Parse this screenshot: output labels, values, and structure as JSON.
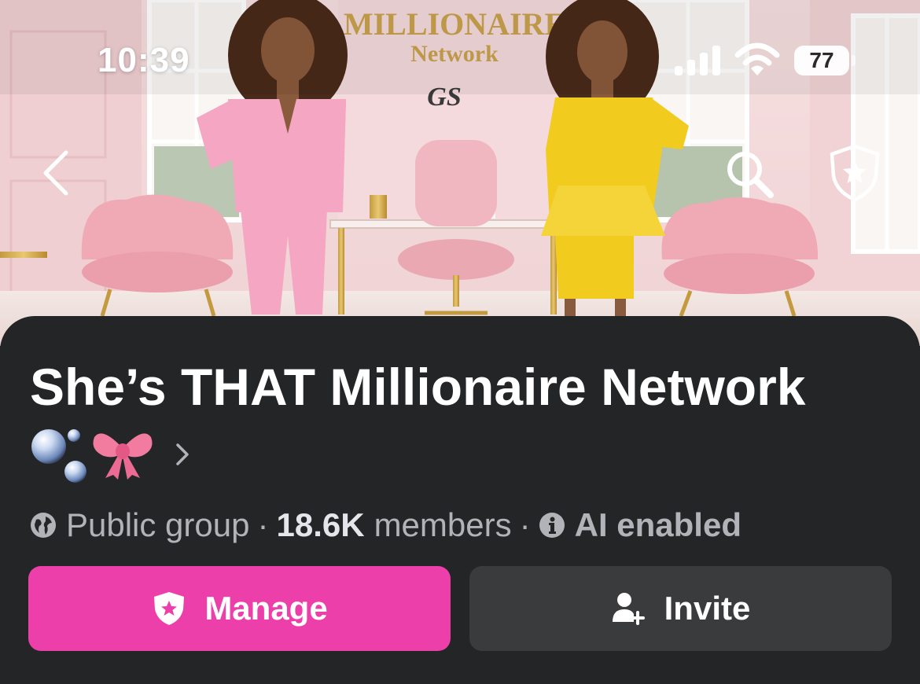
{
  "status_bar": {
    "time": "10:39",
    "battery_level": "77"
  },
  "cover": {
    "brand_title": "MILLIONAIRE",
    "brand_subtitle": "Network",
    "logo_monogram": "GS"
  },
  "group": {
    "name": "She’s THAT Millionaire Network",
    "privacy": "Public group",
    "member_count": "18.6K",
    "members_label": "members",
    "ai_status": "AI enabled"
  },
  "actions": {
    "manage_label": "Manage",
    "invite_label": "Invite"
  },
  "colors": {
    "panel_bg": "#242526",
    "manage_button": "#ec3fa9",
    "invite_button": "#3a3b3c"
  },
  "icons": {
    "back": "chevron-left-icon",
    "search": "search-icon",
    "admin": "admin-shield-icon",
    "privacy": "globe-icon",
    "ai": "info-icon",
    "manage": "shield-star-icon",
    "invite": "add-person-icon"
  }
}
